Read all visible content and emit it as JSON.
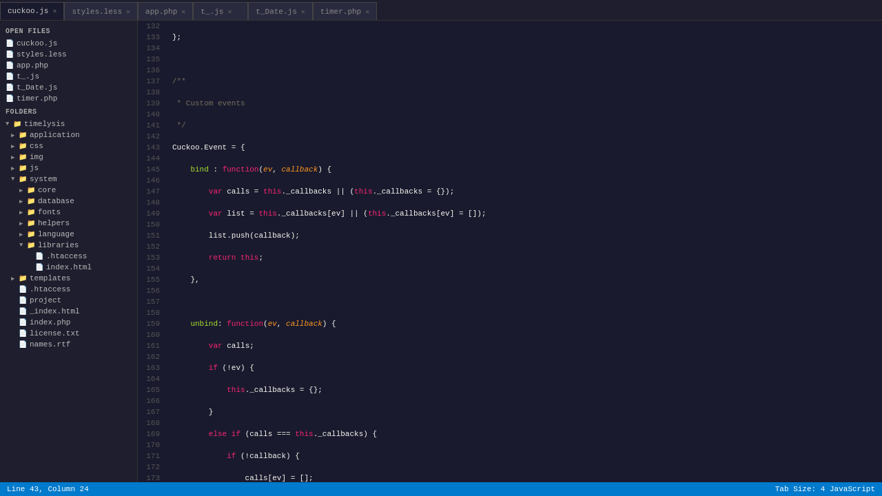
{
  "tabs": [
    {
      "label": "cuckoo.js",
      "active": true
    },
    {
      "label": "styles.less",
      "active": false
    },
    {
      "label": "app.php",
      "active": false
    },
    {
      "label": "t_.js",
      "active": false
    },
    {
      "label": "t_Date.js",
      "active": false
    },
    {
      "label": "timer.php",
      "active": false
    }
  ],
  "sidebar": {
    "open_files_header": "OPEN FILES",
    "open_files": [
      {
        "label": "cuckoo.js"
      },
      {
        "label": "styles.less"
      },
      {
        "label": "app.php"
      },
      {
        "label": "t_.js"
      },
      {
        "label": "t_Date.js"
      },
      {
        "label": "timer.php"
      }
    ],
    "folders_header": "FOLDERS",
    "tree": [
      {
        "label": "timelysis",
        "indent": 0,
        "arrow": "▼",
        "folder": true
      },
      {
        "label": "application",
        "indent": 1,
        "arrow": "▶",
        "folder": true
      },
      {
        "label": "css",
        "indent": 1,
        "arrow": "▶",
        "folder": true
      },
      {
        "label": "img",
        "indent": 1,
        "arrow": "▶",
        "folder": true
      },
      {
        "label": "js",
        "indent": 1,
        "arrow": "▶",
        "folder": true
      },
      {
        "label": "system",
        "indent": 1,
        "arrow": "▼",
        "folder": true
      },
      {
        "label": "core",
        "indent": 2,
        "arrow": "▶",
        "folder": true
      },
      {
        "label": "database",
        "indent": 2,
        "arrow": "▶",
        "folder": true
      },
      {
        "label": "fonts",
        "indent": 2,
        "arrow": "▶",
        "folder": true
      },
      {
        "label": "helpers",
        "indent": 2,
        "arrow": "▶",
        "folder": true
      },
      {
        "label": "language",
        "indent": 2,
        "arrow": "▶",
        "folder": true
      },
      {
        "label": "libraries",
        "indent": 2,
        "arrow": "▼",
        "folder": true
      },
      {
        "label": ".htaccess",
        "indent": 3,
        "arrow": "",
        "folder": false
      },
      {
        "label": "index.html",
        "indent": 3,
        "arrow": "",
        "folder": false
      },
      {
        "label": "templates",
        "indent": 1,
        "arrow": "▶",
        "folder": true
      },
      {
        "label": ".htaccess",
        "indent": 1,
        "arrow": "",
        "folder": false
      },
      {
        "label": "project",
        "indent": 1,
        "arrow": "",
        "folder": false
      },
      {
        "label": "_index.html",
        "indent": 1,
        "arrow": "",
        "folder": false
      },
      {
        "label": "index.php",
        "indent": 1,
        "arrow": "",
        "folder": false
      },
      {
        "label": "license.txt",
        "indent": 1,
        "arrow": "",
        "folder": false
      },
      {
        "label": "names.rtf",
        "indent": 1,
        "arrow": "",
        "folder": false
      }
    ]
  },
  "status": {
    "left": "Line 43, Column 24",
    "right": "Tab Size: 4    JavaScript"
  }
}
